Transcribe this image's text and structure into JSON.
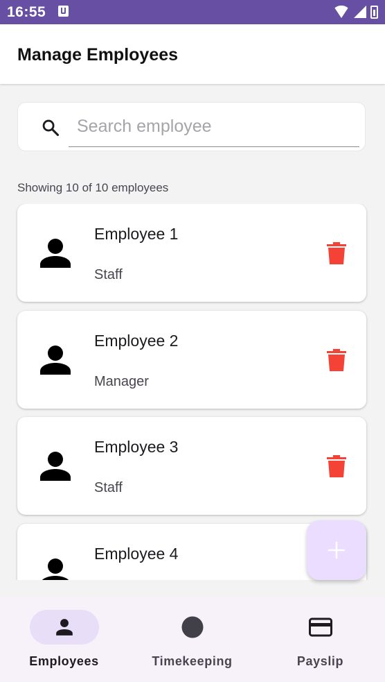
{
  "status_bar": {
    "time": "16:55"
  },
  "header": {
    "title": "Manage Employees"
  },
  "search": {
    "placeholder": "Search employee",
    "value": ""
  },
  "summary": {
    "text": "Showing 10 of 10 employees"
  },
  "employees": [
    {
      "name": "Employee 1",
      "role": "Staff"
    },
    {
      "name": "Employee 2",
      "role": "Manager"
    },
    {
      "name": "Employee 3",
      "role": "Staff"
    },
    {
      "name": "Employee 4",
      "role": ""
    }
  ],
  "colors": {
    "accent": "#6750a4",
    "delete": "#f44336",
    "fab": "#eaddff",
    "nav_active": "#e8def8"
  },
  "icons": {
    "search": "search-icon",
    "person": "person-icon",
    "delete": "trash-icon",
    "add": "plus-icon",
    "timekeeping": "circle-icon",
    "payslip": "credit-card-icon"
  },
  "bottom_nav": {
    "items": [
      {
        "label": "Employees",
        "active": true
      },
      {
        "label": "Timekeeping",
        "active": false
      },
      {
        "label": "Payslip",
        "active": false
      }
    ]
  }
}
